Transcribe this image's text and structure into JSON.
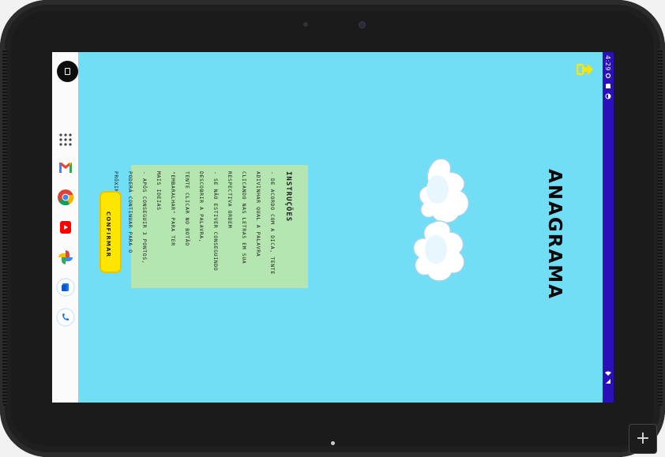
{
  "device": {
    "plus_label": "+"
  },
  "status_bar": {
    "time": "4:29"
  },
  "game": {
    "title": "ANAGRAMA",
    "instructions_title": "INSTRUÇÕES",
    "instructions": [
      "- DE ACORDO COM A DICA, TENTE",
      "ADIVINHAR QUAL A PALAVRA",
      "CLICANDO NAS LETRAS EM SUA",
      "RESPECTIVA ORDEM",
      "",
      "- SE NÃO ESTIVER CONSEGUINDO",
      "DESCOBRIR A PALAVRA,",
      "TENTE CLICAR NO BOTÃO",
      "\"EMBARALHAR\" PARA TER",
      "MAIS IDEIAS",
      "",
      "- APÓS CONSEGUIR 3 PONTOS,",
      "PODERÁ CONTINUAR PARA O",
      "PRÓXIMO JOGO"
    ],
    "confirm_label": "CONFIRMAR"
  },
  "taskbar": {
    "apps": [
      "app-drawer-icon",
      "gmail-icon",
      "chrome-icon",
      "youtube-icon",
      "photos-icon",
      "files-icon",
      "phone-icon"
    ]
  },
  "colors": {
    "background": "#71def5",
    "panel": "#b5e6b1",
    "button": "#ffe600",
    "status_bar": "#2b0fb8"
  }
}
